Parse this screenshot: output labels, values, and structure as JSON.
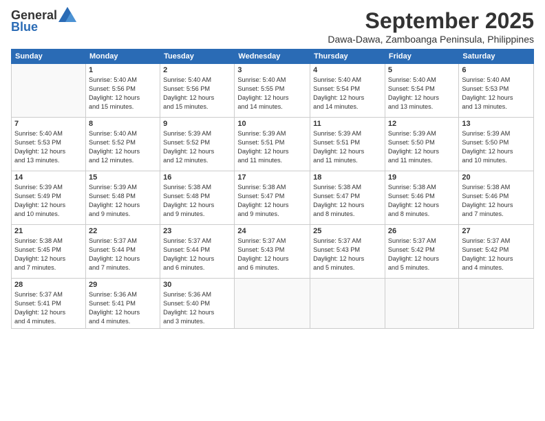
{
  "logo": {
    "general": "General",
    "blue": "Blue"
  },
  "header": {
    "month_year": "September 2025",
    "location": "Dawa-Dawa, Zamboanga Peninsula, Philippines"
  },
  "days_of_week": [
    "Sunday",
    "Monday",
    "Tuesday",
    "Wednesday",
    "Thursday",
    "Friday",
    "Saturday"
  ],
  "weeks": [
    [
      {
        "num": "",
        "info": ""
      },
      {
        "num": "1",
        "info": "Sunrise: 5:40 AM\nSunset: 5:56 PM\nDaylight: 12 hours\nand 15 minutes."
      },
      {
        "num": "2",
        "info": "Sunrise: 5:40 AM\nSunset: 5:56 PM\nDaylight: 12 hours\nand 15 minutes."
      },
      {
        "num": "3",
        "info": "Sunrise: 5:40 AM\nSunset: 5:55 PM\nDaylight: 12 hours\nand 14 minutes."
      },
      {
        "num": "4",
        "info": "Sunrise: 5:40 AM\nSunset: 5:54 PM\nDaylight: 12 hours\nand 14 minutes."
      },
      {
        "num": "5",
        "info": "Sunrise: 5:40 AM\nSunset: 5:54 PM\nDaylight: 12 hours\nand 13 minutes."
      },
      {
        "num": "6",
        "info": "Sunrise: 5:40 AM\nSunset: 5:53 PM\nDaylight: 12 hours\nand 13 minutes."
      }
    ],
    [
      {
        "num": "7",
        "info": "Sunrise: 5:40 AM\nSunset: 5:53 PM\nDaylight: 12 hours\nand 13 minutes."
      },
      {
        "num": "8",
        "info": "Sunrise: 5:40 AM\nSunset: 5:52 PM\nDaylight: 12 hours\nand 12 minutes."
      },
      {
        "num": "9",
        "info": "Sunrise: 5:39 AM\nSunset: 5:52 PM\nDaylight: 12 hours\nand 12 minutes."
      },
      {
        "num": "10",
        "info": "Sunrise: 5:39 AM\nSunset: 5:51 PM\nDaylight: 12 hours\nand 11 minutes."
      },
      {
        "num": "11",
        "info": "Sunrise: 5:39 AM\nSunset: 5:51 PM\nDaylight: 12 hours\nand 11 minutes."
      },
      {
        "num": "12",
        "info": "Sunrise: 5:39 AM\nSunset: 5:50 PM\nDaylight: 12 hours\nand 11 minutes."
      },
      {
        "num": "13",
        "info": "Sunrise: 5:39 AM\nSunset: 5:50 PM\nDaylight: 12 hours\nand 10 minutes."
      }
    ],
    [
      {
        "num": "14",
        "info": "Sunrise: 5:39 AM\nSunset: 5:49 PM\nDaylight: 12 hours\nand 10 minutes."
      },
      {
        "num": "15",
        "info": "Sunrise: 5:39 AM\nSunset: 5:48 PM\nDaylight: 12 hours\nand 9 minutes."
      },
      {
        "num": "16",
        "info": "Sunrise: 5:38 AM\nSunset: 5:48 PM\nDaylight: 12 hours\nand 9 minutes."
      },
      {
        "num": "17",
        "info": "Sunrise: 5:38 AM\nSunset: 5:47 PM\nDaylight: 12 hours\nand 9 minutes."
      },
      {
        "num": "18",
        "info": "Sunrise: 5:38 AM\nSunset: 5:47 PM\nDaylight: 12 hours\nand 8 minutes."
      },
      {
        "num": "19",
        "info": "Sunrise: 5:38 AM\nSunset: 5:46 PM\nDaylight: 12 hours\nand 8 minutes."
      },
      {
        "num": "20",
        "info": "Sunrise: 5:38 AM\nSunset: 5:46 PM\nDaylight: 12 hours\nand 7 minutes."
      }
    ],
    [
      {
        "num": "21",
        "info": "Sunrise: 5:38 AM\nSunset: 5:45 PM\nDaylight: 12 hours\nand 7 minutes."
      },
      {
        "num": "22",
        "info": "Sunrise: 5:37 AM\nSunset: 5:44 PM\nDaylight: 12 hours\nand 7 minutes."
      },
      {
        "num": "23",
        "info": "Sunrise: 5:37 AM\nSunset: 5:44 PM\nDaylight: 12 hours\nand 6 minutes."
      },
      {
        "num": "24",
        "info": "Sunrise: 5:37 AM\nSunset: 5:43 PM\nDaylight: 12 hours\nand 6 minutes."
      },
      {
        "num": "25",
        "info": "Sunrise: 5:37 AM\nSunset: 5:43 PM\nDaylight: 12 hours\nand 5 minutes."
      },
      {
        "num": "26",
        "info": "Sunrise: 5:37 AM\nSunset: 5:42 PM\nDaylight: 12 hours\nand 5 minutes."
      },
      {
        "num": "27",
        "info": "Sunrise: 5:37 AM\nSunset: 5:42 PM\nDaylight: 12 hours\nand 4 minutes."
      }
    ],
    [
      {
        "num": "28",
        "info": "Sunrise: 5:37 AM\nSunset: 5:41 PM\nDaylight: 12 hours\nand 4 minutes."
      },
      {
        "num": "29",
        "info": "Sunrise: 5:36 AM\nSunset: 5:41 PM\nDaylight: 12 hours\nand 4 minutes."
      },
      {
        "num": "30",
        "info": "Sunrise: 5:36 AM\nSunset: 5:40 PM\nDaylight: 12 hours\nand 3 minutes."
      },
      {
        "num": "",
        "info": ""
      },
      {
        "num": "",
        "info": ""
      },
      {
        "num": "",
        "info": ""
      },
      {
        "num": "",
        "info": ""
      }
    ]
  ]
}
